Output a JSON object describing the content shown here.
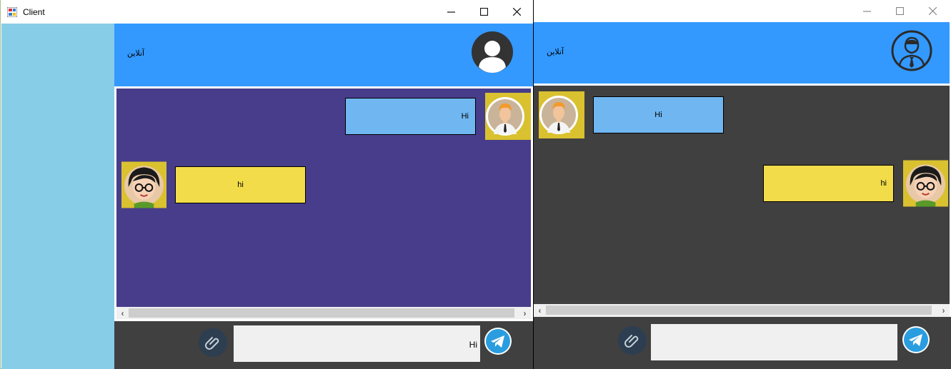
{
  "client_window": {
    "title": "Client",
    "status": "آنلاین",
    "messages": [
      {
        "text": "Hi",
        "side": "right",
        "sender": "man"
      },
      {
        "text": "hi",
        "side": "left",
        "sender": "woman"
      }
    ],
    "input_value": "Hi"
  },
  "server_window": {
    "status": "آنلاین",
    "messages": [
      {
        "text": "Hi",
        "side": "left",
        "sender": "man"
      },
      {
        "text": "hi",
        "side": "right",
        "sender": "woman"
      }
    ],
    "input_value": ""
  },
  "icons": {
    "attach": "paperclip-icon",
    "send": "telegram-send-icon",
    "minimize": "minimize-icon",
    "maximize": "maximize-icon",
    "close": "close-icon"
  },
  "colors": {
    "header_blue": "#3399ff",
    "client_chat_bg": "#473d8a",
    "server_chat_bg": "#404040",
    "sidebar": "#87cde8",
    "bubble_blue": "#70b6f0",
    "bubble_yellow": "#f2dc4a"
  }
}
